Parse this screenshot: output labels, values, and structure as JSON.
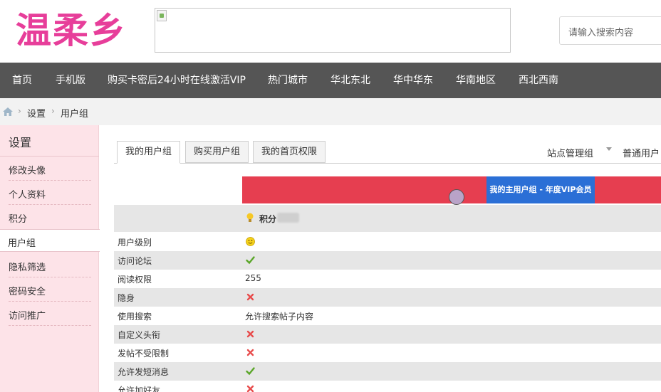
{
  "logo": {
    "text": "温柔乡"
  },
  "search": {
    "placeholder": "请输入搜索内容"
  },
  "nav": {
    "items": [
      "首页",
      "手机版",
      "购买卡密后24小时在线激活VIP",
      "热门城市",
      "华北东北",
      "华中华东",
      "华南地区",
      "西北西南"
    ]
  },
  "breadcrumb": {
    "items": [
      "设置",
      "用户组"
    ]
  },
  "sidebar": {
    "title": "设置",
    "items": [
      "修改头像",
      "个人资料",
      "积分",
      "用户组",
      "隐私筛选",
      "密码安全",
      "访问推广"
    ],
    "active_index": 3
  },
  "tabs": [
    "我的用户组",
    "购买用户组",
    "我的首页权限"
  ],
  "right_links": {
    "site_admin": "站点管理组",
    "normal_user": "普通用户"
  },
  "table": {
    "group_header": "我的主用户组 - 年度VIP会员",
    "score_label": "积分",
    "rows": [
      {
        "label": "用户级别",
        "value": "smile-icon"
      },
      {
        "label": "访问论坛",
        "value": "check-icon"
      },
      {
        "label": "阅读权限",
        "value": "255"
      },
      {
        "label": "隐身",
        "value": "cross-icon"
      },
      {
        "label": "使用搜索",
        "value": "允许搜索帖子内容"
      },
      {
        "label": "自定义头衔",
        "value": "cross-icon"
      },
      {
        "label": "发帖不受限制",
        "value": "cross-icon"
      },
      {
        "label": "允许发短消息",
        "value": "check-icon"
      },
      {
        "label": "允许加好友",
        "value": "cross-icon"
      }
    ]
  },
  "colors": {
    "nav_bg": "#555555",
    "sidebar_bg": "#fde3e8",
    "red_bar": "#e63e50",
    "blue_box": "#2b6fd6",
    "check": "#5aa628",
    "cross": "#e84c4c"
  }
}
